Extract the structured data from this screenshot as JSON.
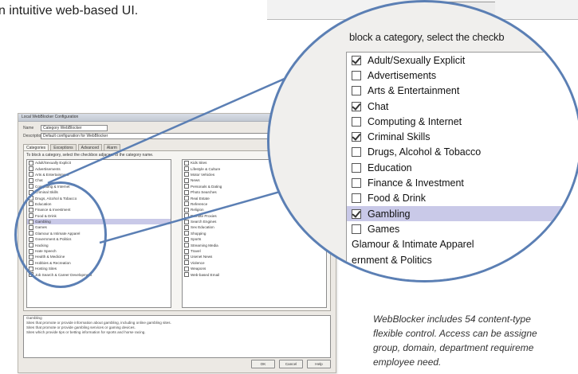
{
  "top_text": "n intuitive web-based UI.",
  "mini_dialog": {
    "title": "Local WebBlocker Configuration",
    "name_label": "Name",
    "name_value": "Category WebBlocker",
    "desc_label": "Description",
    "desc_value": "Default configuration for WebBlocker",
    "tabs": [
      "Categories",
      "Exceptions",
      "Advanced",
      "Alarm"
    ],
    "instruction": "To block a category, select the checkbox adjacent to the category name.",
    "left_items": [
      {
        "label": "Adult/Sexually Explicit",
        "checked": true
      },
      {
        "label": "Advertisements",
        "checked": false
      },
      {
        "label": "Arts & Entertainment",
        "checked": false
      },
      {
        "label": "Chat",
        "checked": true
      },
      {
        "label": "Computing & Internet",
        "checked": false
      },
      {
        "label": "Criminal Skills",
        "checked": true
      },
      {
        "label": "Drugs, Alcohol & Tobacco",
        "checked": false
      },
      {
        "label": "Education",
        "checked": false
      },
      {
        "label": "Finance & Investment",
        "checked": false
      },
      {
        "label": "Food & Drink",
        "checked": false
      },
      {
        "label": "Gambling",
        "checked": true,
        "selected": true
      },
      {
        "label": "Games",
        "checked": false
      },
      {
        "label": "Glamour & Intimate Apparel",
        "checked": false
      },
      {
        "label": "Government & Politics",
        "checked": false
      },
      {
        "label": "Hacking",
        "checked": true
      },
      {
        "label": "Hate Speech",
        "checked": true
      },
      {
        "label": "Health & Medicine",
        "checked": false
      },
      {
        "label": "Hobbies & Recreation",
        "checked": false
      },
      {
        "label": "Hosting Sites",
        "checked": false
      },
      {
        "label": "Job Search & Career Development",
        "checked": false
      }
    ],
    "right_items": [
      {
        "label": "Kids Sites",
        "checked": false
      },
      {
        "label": "Lifestyle & Culture",
        "checked": false
      },
      {
        "label": "Motor Vehicles",
        "checked": false
      },
      {
        "label": "News",
        "checked": false
      },
      {
        "label": "Personals & Dating",
        "checked": true
      },
      {
        "label": "Photo Searches",
        "checked": false
      },
      {
        "label": "Real Estate",
        "checked": false
      },
      {
        "label": "Reference",
        "checked": false
      },
      {
        "label": "Religion",
        "checked": false
      },
      {
        "label": "Remote Proxies",
        "checked": true
      },
      {
        "label": "Search Engines",
        "checked": false
      },
      {
        "label": "Sex Education",
        "checked": false
      },
      {
        "label": "Shopping",
        "checked": false
      },
      {
        "label": "Sports",
        "checked": false
      },
      {
        "label": "Streaming Media",
        "checked": false
      },
      {
        "label": "Travel",
        "checked": false
      },
      {
        "label": "Usenet News",
        "checked": false
      },
      {
        "label": "Violence",
        "checked": true
      },
      {
        "label": "Weapons",
        "checked": true
      },
      {
        "label": "Web-based Email",
        "checked": false
      }
    ],
    "notes": [
      "Gambling",
      "Sites that promote or provide information about gambling, including online gambling sites.",
      "Sites that promote or provide gambling services or gaming devices.",
      "Sites which provide tips or betting information for sports and horse racing."
    ],
    "buttons": [
      "OK",
      "Cancel",
      "Help"
    ]
  },
  "magnified": {
    "instruction": "block a category, select the checkb",
    "items": [
      {
        "label": "Adult/Sexually Explicit",
        "checked": true,
        "selected": false,
        "box": true
      },
      {
        "label": "Advertisements",
        "checked": false,
        "selected": false,
        "box": true
      },
      {
        "label": "Arts & Entertainment",
        "checked": false,
        "selected": false,
        "box": true
      },
      {
        "label": "Chat",
        "checked": true,
        "selected": false,
        "box": true
      },
      {
        "label": "Computing & Internet",
        "checked": false,
        "selected": false,
        "box": true
      },
      {
        "label": "Criminal Skills",
        "checked": true,
        "selected": false,
        "box": true
      },
      {
        "label": "Drugs, Alcohol & Tobacco",
        "checked": false,
        "selected": false,
        "box": true
      },
      {
        "label": "Education",
        "checked": false,
        "selected": false,
        "box": true
      },
      {
        "label": "Finance & Investment",
        "checked": false,
        "selected": false,
        "box": true
      },
      {
        "label": "Food & Drink",
        "checked": false,
        "selected": false,
        "box": true
      },
      {
        "label": "Gambling",
        "checked": true,
        "selected": true,
        "box": true
      },
      {
        "label": "Games",
        "checked": false,
        "selected": false,
        "box": true
      },
      {
        "label": "Glamour & Intimate Apparel",
        "checked": false,
        "selected": false,
        "box": false
      },
      {
        "label": "ernment & Politics",
        "checked": false,
        "selected": false,
        "box": false
      }
    ]
  },
  "caption": [
    "WebBlocker includes 54 content-type",
    "flexible control. Access can be assigne",
    "group, domain, department requireme",
    "employee need."
  ],
  "colors": {
    "circle": "#5b7fb4",
    "selection": "#c9c9e8"
  }
}
